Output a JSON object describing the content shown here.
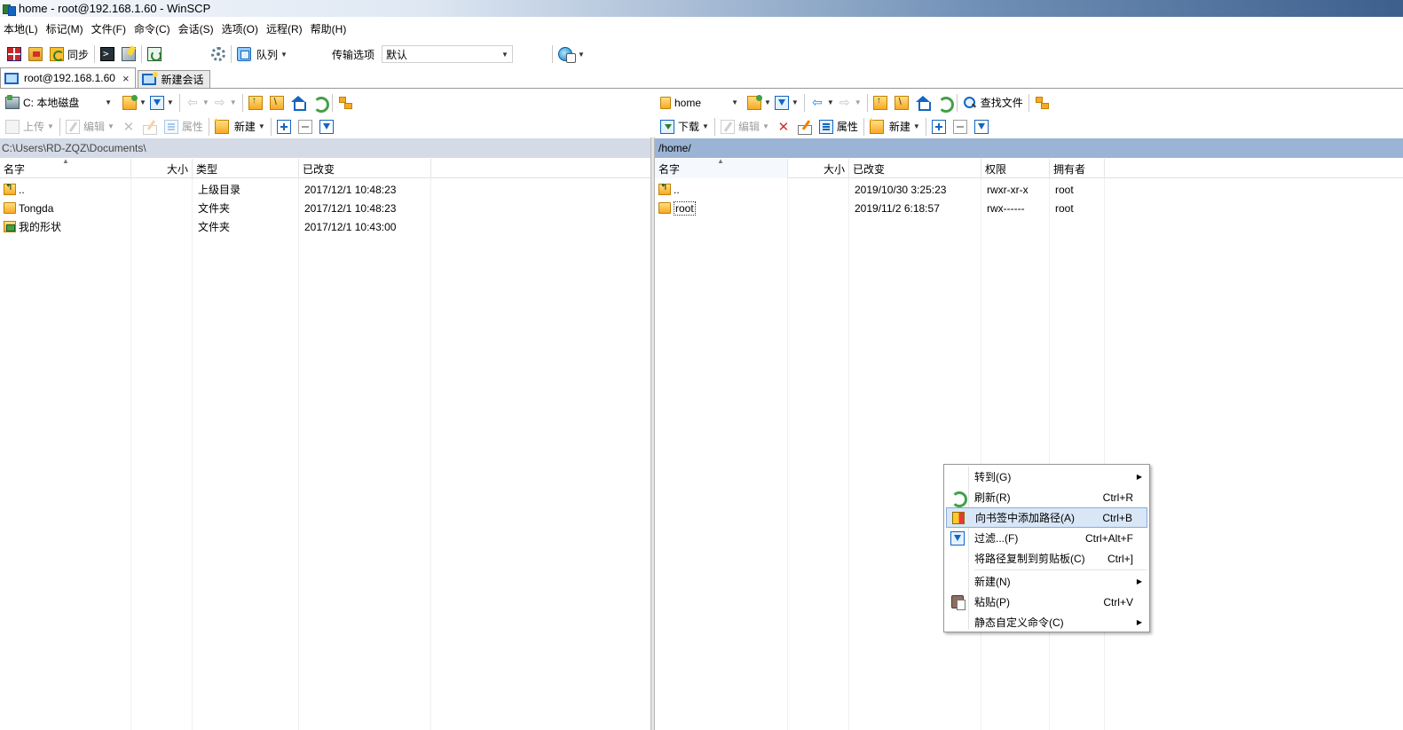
{
  "window": {
    "title": "home - root@192.168.1.60 - WinSCP"
  },
  "menu": [
    "本地(L)",
    "标记(M)",
    "文件(F)",
    "命令(C)",
    "会话(S)",
    "选项(O)",
    "远程(R)",
    "帮助(H)"
  ],
  "toolbar": {
    "sync_label": "同步",
    "queue_label": "队列",
    "transfer_label": "传输选项",
    "transfer_value": "默认"
  },
  "tabs": [
    {
      "label": "root@192.168.1.60",
      "close": "×"
    },
    {
      "label": "新建会话"
    }
  ],
  "left": {
    "drive": "C: 本地磁盘",
    "upload_label": "上传",
    "edit_label": "编辑",
    "props_label": "属性",
    "new_label": "新建",
    "path": "C:\\Users\\RD-ZQZ\\Documents\\",
    "columns": [
      "名字",
      "大小",
      "类型",
      "已改变"
    ],
    "rows": [
      {
        "icon": "updir-icon",
        "name": "..",
        "size": "",
        "type": "上级目录",
        "changed": "2017/12/1  10:48:23"
      },
      {
        "icon": "folder-icon",
        "name": "Tongda",
        "size": "",
        "type": "文件夹",
        "changed": "2017/12/1  10:48:23"
      },
      {
        "icon": "shapes-folder-icon",
        "name": "我的形状",
        "size": "",
        "type": "文件夹",
        "changed": "2017/12/1  10:43:00"
      }
    ]
  },
  "right": {
    "dir": "home",
    "find_label": "查找文件",
    "download_label": "下载",
    "edit_label": "编辑",
    "props_label": "属性",
    "new_label": "新建",
    "path": "/home/",
    "columns": [
      "名字",
      "大小",
      "已改变",
      "权限",
      "拥有者"
    ],
    "rows": [
      {
        "icon": "updir-icon",
        "name": "..",
        "size": "",
        "changed": "2019/10/30 3:25:23",
        "rights": "rwxr-xr-x",
        "owner": "root"
      },
      {
        "icon": "folder-icon",
        "name": "root",
        "size": "",
        "changed": "2019/11/2 6:18:57",
        "rights": "rwx------",
        "owner": "root"
      }
    ]
  },
  "context_menu": {
    "items": [
      {
        "label": "转到(G)",
        "key": "",
        "submenu": true
      },
      {
        "label": "刷新(R)",
        "key": "Ctrl+R"
      },
      {
        "label": "向书签中添加路径(A)",
        "key": "Ctrl+B",
        "highlighted": true
      },
      {
        "label": "过滤...(F)",
        "key": "Ctrl+Alt+F"
      },
      {
        "label": "将路径复制到剪贴板(C)",
        "key": "Ctrl+]"
      },
      {
        "label": "新建(N)",
        "key": "",
        "submenu": true
      },
      {
        "label": "粘贴(P)",
        "key": "Ctrl+V"
      },
      {
        "label": "静态自定义命令(C)",
        "key": "",
        "submenu": true
      }
    ]
  },
  "colors": {
    "highlight": "#d8e6f6",
    "left_path_bg": "#d4dbe6",
    "right_path_bg": "#9bb3d4"
  }
}
